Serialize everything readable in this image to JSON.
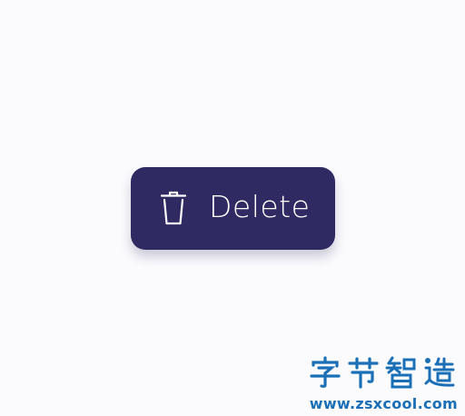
{
  "delete_button": {
    "label": "Delete",
    "icon": "trash-icon",
    "background_color": "#302a63",
    "text_color": "#ffffff"
  },
  "watermark": {
    "logo_text": "字节智造",
    "url": "www.zsxcool.com",
    "color": "#1b6fb6"
  }
}
